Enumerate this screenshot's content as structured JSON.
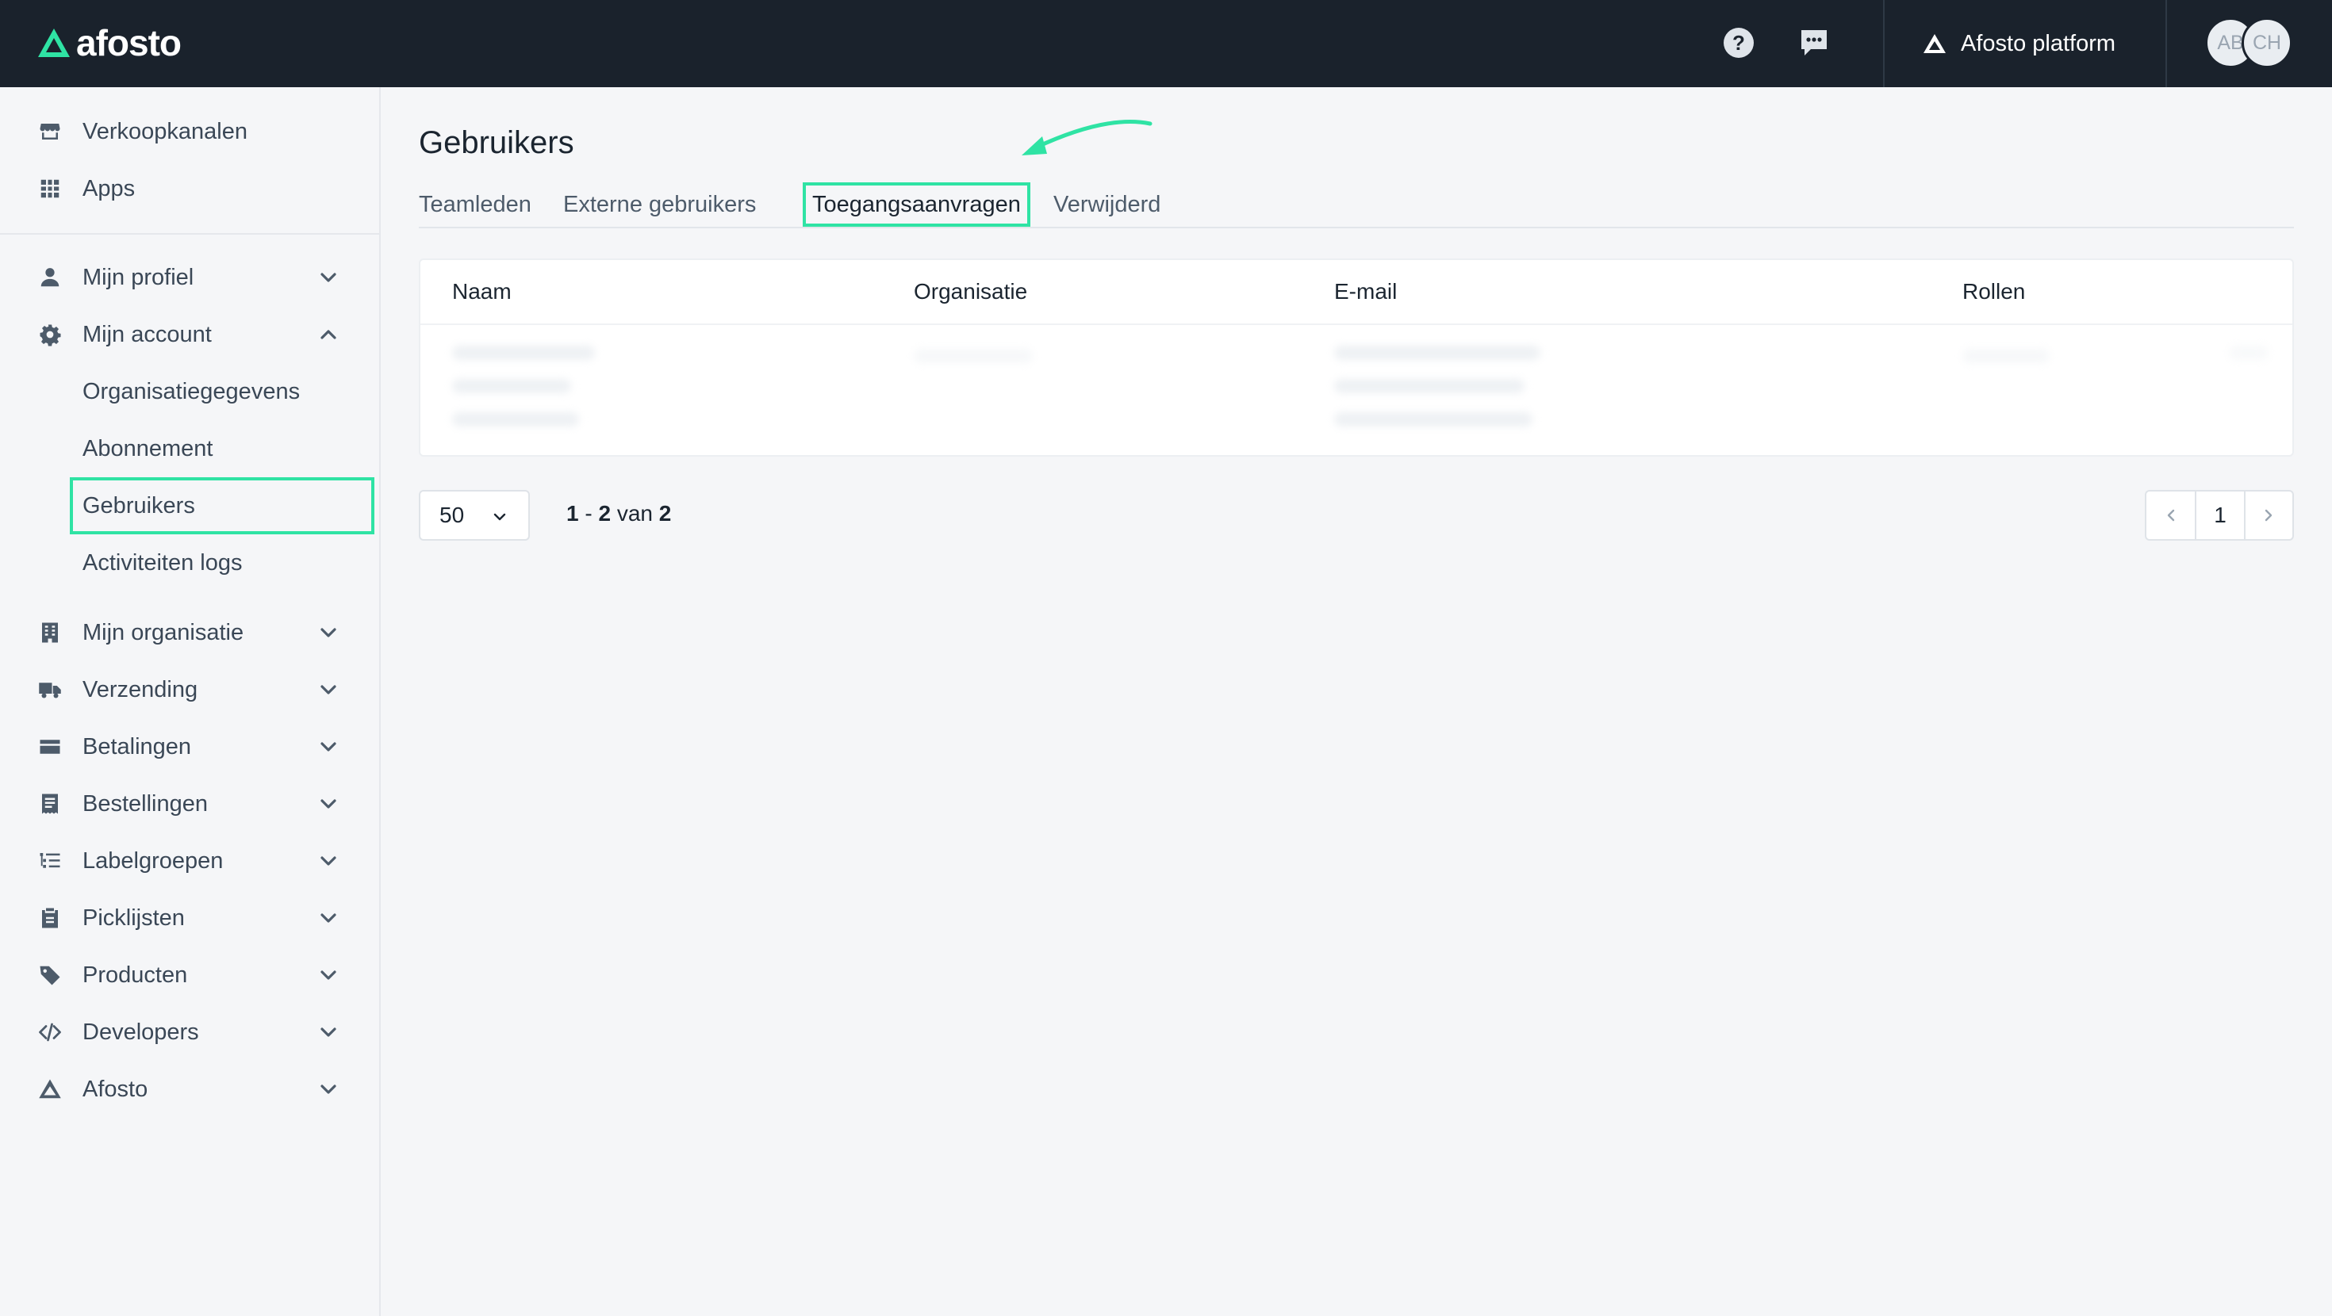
{
  "topbar": {
    "logo_text": "afosto",
    "help_icon": "question-circle-icon",
    "chat_icon": "chat-bubble-icon",
    "platform_label": "Afosto platform",
    "avatars": [
      "AB",
      "CH"
    ]
  },
  "sidebar": {
    "top_items": [
      {
        "label": "Verkoopkanalen",
        "icon": "store-icon"
      },
      {
        "label": "Apps",
        "icon": "grid-icon"
      }
    ],
    "items": [
      {
        "label": "Mijn profiel",
        "icon": "user-icon"
      },
      {
        "label": "Mijn account",
        "icon": "gear-icon"
      },
      {
        "label": "Mijn organisatie",
        "icon": "building-icon"
      },
      {
        "label": "Verzending",
        "icon": "truck-icon"
      },
      {
        "label": "Betalingen",
        "icon": "credit-card-icon"
      },
      {
        "label": "Bestellingen",
        "icon": "receipt-icon"
      },
      {
        "label": "Labelgroepen",
        "icon": "list-icon"
      },
      {
        "label": "Picklijsten",
        "icon": "clipboard-icon"
      },
      {
        "label": "Producten",
        "icon": "tag-icon"
      },
      {
        "label": "Developers",
        "icon": "code-icon"
      },
      {
        "label": "Afosto",
        "icon": "afosto-logo-icon"
      }
    ],
    "account_sub": [
      {
        "label": "Organisatiegegevens"
      },
      {
        "label": "Abonnement"
      },
      {
        "label": "Gebruikers",
        "active": true
      },
      {
        "label": "Activiteiten logs"
      }
    ]
  },
  "main": {
    "title": "Gebruikers",
    "tabs": [
      {
        "label": "Teamleden"
      },
      {
        "label": "Externe gebruikers"
      },
      {
        "label": "Toegangsaanvragen",
        "active": true
      },
      {
        "label": "Verwijderd"
      }
    ],
    "table": {
      "columns": [
        "Naam",
        "Organisatie",
        "E-mail",
        "Rollen"
      ]
    },
    "pagination": {
      "per_page": "50",
      "range_start": "1",
      "range_end": "2",
      "range_of": "van",
      "total": "2",
      "current_page": "1"
    }
  },
  "colors": {
    "topbar": "#1a222c",
    "accent": "#2fe3a4",
    "background": "#f5f6f8"
  }
}
